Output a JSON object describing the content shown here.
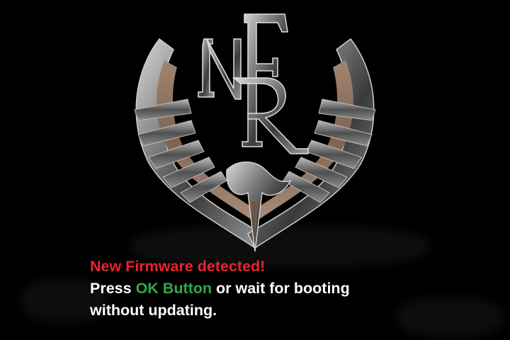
{
  "logo": {
    "name": "NFR emblem",
    "letters": "NFR",
    "icon": "phoenix-wings-emblem"
  },
  "message": {
    "line1": "New Firmware detected!",
    "line2_prefix": "Press ",
    "line2_highlight": "OK Button",
    "line2_suffix": " or wait for booting",
    "line3": "without updating."
  },
  "colors": {
    "background": "#000000",
    "alert": "#e8242b",
    "highlight": "#2ea84a",
    "text": "#ffffff"
  }
}
